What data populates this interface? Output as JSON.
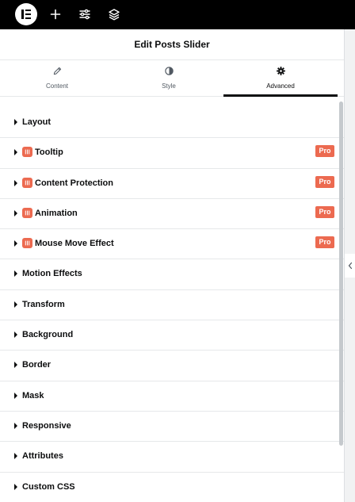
{
  "panel": {
    "title": "Edit Posts Slider"
  },
  "tabs": [
    {
      "label": "Content",
      "icon": "pencil-icon"
    },
    {
      "label": "Style",
      "icon": "half-circle-icon"
    },
    {
      "label": "Advanced",
      "icon": "gear-icon",
      "active": true
    }
  ],
  "sections": [
    {
      "label": "Layout"
    },
    {
      "label": "Tooltip",
      "pro": "Pro"
    },
    {
      "label": "Content Protection",
      "pro": "Pro"
    },
    {
      "label": "Animation",
      "pro": "Pro"
    },
    {
      "label": "Mouse Move Effect",
      "pro": "Pro"
    },
    {
      "label": "Motion Effects"
    },
    {
      "label": "Transform"
    },
    {
      "label": "Background"
    },
    {
      "label": "Border"
    },
    {
      "label": "Mask"
    },
    {
      "label": "Responsive"
    },
    {
      "label": "Attributes"
    },
    {
      "label": "Custom CSS"
    }
  ],
  "colors": {
    "topbar": "#000000",
    "pro_badge": "#ec6a50",
    "text": "#0c0d0e",
    "muted": "#515962"
  }
}
